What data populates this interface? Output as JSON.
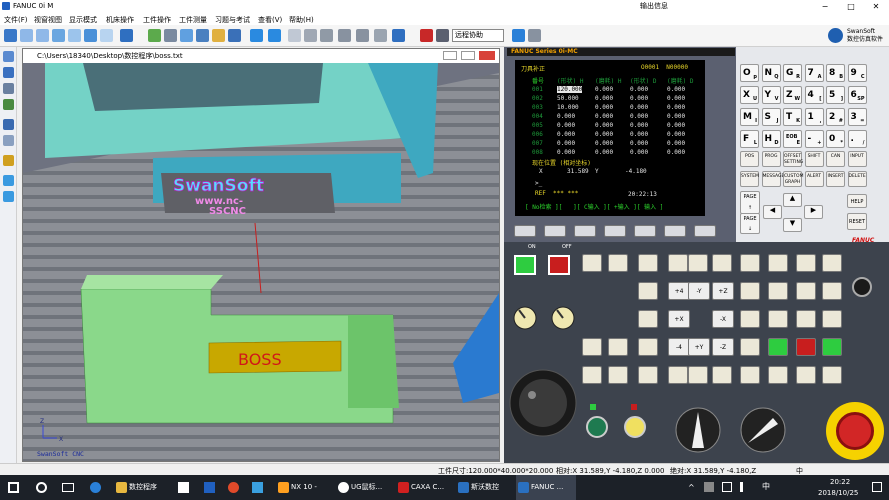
{
  "app": {
    "title": "FANUC 0i M",
    "output_panel": "输出信息"
  },
  "window_controls": {
    "minimize": "−",
    "maximize": "□",
    "close": "✕"
  },
  "menu": [
    "文件(F)",
    "视窗视图",
    "显示模式",
    "机床操作",
    "工件操作",
    "工件测量",
    "习题与考试",
    "查看(V)",
    "帮助(H)"
  ],
  "toolbar": {
    "remote_label": "远程协助"
  },
  "brand": {
    "name": "SwanSoft",
    "subtitle": "数控仿真软件"
  },
  "viewport": {
    "path": "C:\\Users\\18340\\Desktop\\数控程序\\boss.txt",
    "workpiece_label": "BOSS",
    "banner_line1": "SwanSoft",
    "banner_line2": "www.nc-",
    "banner_line3": "SSCNC",
    "corner_label": "SwanSoft CNC",
    "axis_x": "X",
    "axis_z": "Z"
  },
  "controller": {
    "series": "FANUC Series 0i-MC",
    "screen": {
      "title": "刀具补正",
      "prog": "O0001  N00000",
      "header": [
        "番号",
        "(形状) H",
        "(磨耗) H",
        "(形状) D",
        "(磨耗) D"
      ],
      "rows": [
        [
          "001",
          "120.000",
          "0.000",
          "0.000",
          "0.000"
        ],
        [
          "002",
          "50.000",
          "0.000",
          "0.000",
          "0.000"
        ],
        [
          "003",
          "10.000",
          "0.000",
          "0.000",
          "0.000"
        ],
        [
          "004",
          "0.000",
          "0.000",
          "0.000",
          "0.000"
        ],
        [
          "005",
          "0.000",
          "0.000",
          "0.000",
          "0.000"
        ],
        [
          "006",
          "0.000",
          "0.000",
          "0.000",
          "0.000"
        ],
        [
          "007",
          "0.000",
          "0.000",
          "0.000",
          "0.000"
        ],
        [
          "008",
          "0.000",
          "0.000",
          "0.000",
          "0.000"
        ]
      ],
      "pos_label": "现在位置 (相对坐标)",
      "pos_x_label": "X",
      "pos_x": "31.589",
      "pos_y_label": "Y",
      "pos_y": "-4.180",
      "prompt": ">_",
      "mode": "REF  *** ***",
      "time": "20:22:13",
      "softkeys": "[ No检索 ][   ][ C输入 ][ +输入 ][ 输入 ]"
    },
    "keys_addr": [
      [
        "O",
        "p"
      ],
      [
        "N",
        "Q"
      ],
      [
        "G",
        "R"
      ],
      [
        "7",
        "A"
      ],
      [
        "8",
        "B"
      ],
      [
        "9",
        "C"
      ],
      [
        "X",
        "U"
      ],
      [
        "Y",
        "V"
      ],
      [
        "Z",
        "W"
      ],
      [
        "4",
        "["
      ],
      [
        "5",
        "]"
      ],
      [
        "6",
        "SP"
      ],
      [
        "M",
        "I"
      ],
      [
        "S",
        "J"
      ],
      [
        "T",
        "K"
      ],
      [
        "1",
        ","
      ],
      [
        "2",
        "#"
      ],
      [
        "3",
        "="
      ],
      [
        "F",
        "L"
      ],
      [
        "H",
        "D"
      ],
      [
        "EOB",
        "E"
      ],
      [
        "-",
        "+"
      ],
      [
        "0",
        "*"
      ],
      [
        ".",
        "/"
      ]
    ],
    "keys_func": [
      "POS",
      "PROG",
      "OFFSET SETTING",
      "SHIFT",
      "CAN",
      "INPUT",
      "SYSTEM",
      "MESSAGE",
      "CUSTOM GRAPH",
      "ALERT",
      "INSERT",
      "DELETE"
    ],
    "page_up": "PAGE ↑",
    "page_down": "PAGE ↓",
    "help": "HELP",
    "reset": "RESET",
    "fanuc": "FANUC",
    "power_on": "ON",
    "power_off": "OFF",
    "jog": [
      "+4",
      "-Y",
      "+Z",
      "+X",
      "-X",
      "-4",
      "+Y",
      "-Z"
    ],
    "spindle_label": "主轴",
    "panel_labels": [
      "主轴正转",
      "主轴停",
      "主轴反转"
    ]
  },
  "status": {
    "size": "工件尺寸:120.000*40.000*20.000",
    "rel": "相对:X  31.589,Y  -4.180,Z  0.000",
    "abs": "绝对:X  31.589,Y  -4.180,Z",
    "ime": "中"
  },
  "taskbar": {
    "items": [
      "数控程序",
      "NX 10 -",
      "UG鼠标...",
      "CAXA C...",
      "斯沃数控",
      "FANUC ..."
    ],
    "time": "20:22",
    "date": "2018/10/25",
    "input": "中"
  },
  "colors": {
    "screen_bg": "#000000",
    "screen_text": "#1ecd1e",
    "accent_green": "#2ecc40",
    "accent_red": "#c81e1e",
    "part_green": "#7fd07a",
    "boss_yellow": "#c8a800"
  }
}
